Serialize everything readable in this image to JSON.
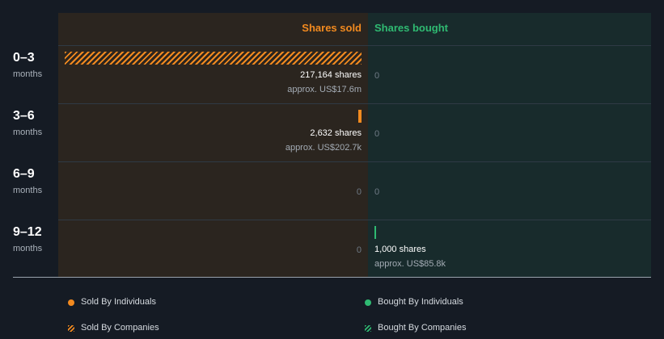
{
  "chart_data": {
    "type": "bar",
    "orientation": "horizontal",
    "series_headers": {
      "sold": "Shares sold",
      "bought": "Shares bought"
    },
    "categories": [
      {
        "period": "0–3",
        "unit": "months"
      },
      {
        "period": "3–6",
        "unit": "months"
      },
      {
        "period": "6–9",
        "unit": "months"
      },
      {
        "period": "9–12",
        "unit": "months"
      }
    ],
    "sold": [
      {
        "shares": 217164,
        "shares_label": "217,164 shares",
        "approx_label": "approx. US$17.6m",
        "type": "companies",
        "zero_label": ""
      },
      {
        "shares": 2632,
        "shares_label": "2,632 shares",
        "approx_label": "approx. US$202.7k",
        "type": "individuals",
        "zero_label": ""
      },
      {
        "shares": 0,
        "shares_label": "",
        "approx_label": "",
        "type": "none",
        "zero_label": "0"
      },
      {
        "shares": 0,
        "shares_label": "",
        "approx_label": "",
        "type": "none",
        "zero_label": "0"
      }
    ],
    "bought": [
      {
        "shares": 0,
        "shares_label": "",
        "approx_label": "",
        "type": "none",
        "zero_label": "0"
      },
      {
        "shares": 0,
        "shares_label": "",
        "approx_label": "",
        "type": "none",
        "zero_label": "0"
      },
      {
        "shares": 0,
        "shares_label": "",
        "approx_label": "",
        "type": "none",
        "zero_label": "0"
      },
      {
        "shares": 1000,
        "shares_label": "1,000 shares",
        "approx_label": "approx. US$85.8k",
        "type": "individuals",
        "zero_label": ""
      }
    ],
    "legend": [
      {
        "key": "sold-individuals",
        "label": "Sold By Individuals",
        "marker": "dot",
        "color": "#f28a1f"
      },
      {
        "key": "bought-individuals",
        "label": "Bought By Individuals",
        "marker": "dot",
        "color": "#2fba72"
      },
      {
        "key": "sold-companies",
        "label": "Sold By Companies",
        "marker": "hatch",
        "color": "#f28a1f"
      },
      {
        "key": "bought-companies",
        "label": "Bought By Companies",
        "marker": "hatch",
        "color": "#2fba72"
      }
    ],
    "colors": {
      "sold": "#f28a1f",
      "bought": "#2fba72",
      "sold_bg": "#2b251f",
      "bought_bg": "#182b2c"
    },
    "grid": true,
    "legend_position": "bottom"
  }
}
